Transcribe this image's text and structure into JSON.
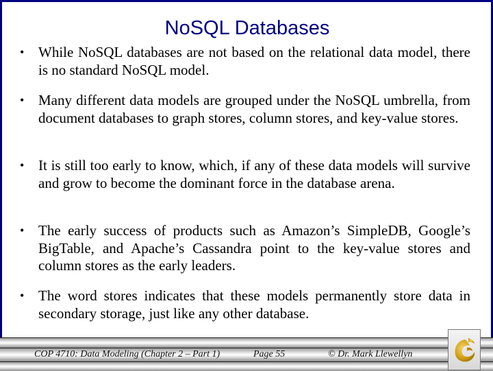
{
  "slide": {
    "title": "NoSQL Databases",
    "bullet_glyph": "•",
    "bullets": [
      "While NoSQL databases are not based on the relational data model, there is no standard NoSQL model.",
      "Many different data models are grouped under the NoSQL umbrella, from document databases to graph stores, column stores, and key-value stores.",
      "It is still too early to know, which, if any of these data models will survive and grow to become the dominant force in the database arena.",
      "The early success of products such as Amazon’s SimpleDB, Google’s BigTable, and Apache’s Cassandra point to the key-value stores and column stores as the early leaders.",
      "The word stores indicates that these models permanently store data in secondary storage, just like any other database."
    ]
  },
  "footer": {
    "course": "COP 4710: Data Modeling (Chapter 2 – Part 1)",
    "page": "Page 55",
    "copyright": "© Dr. Mark Llewellyn",
    "logo_icon": "pegasus-logo-icon"
  },
  "colors": {
    "frame": "#000080",
    "title": "#000080",
    "logo_gold": "#d4a017"
  }
}
